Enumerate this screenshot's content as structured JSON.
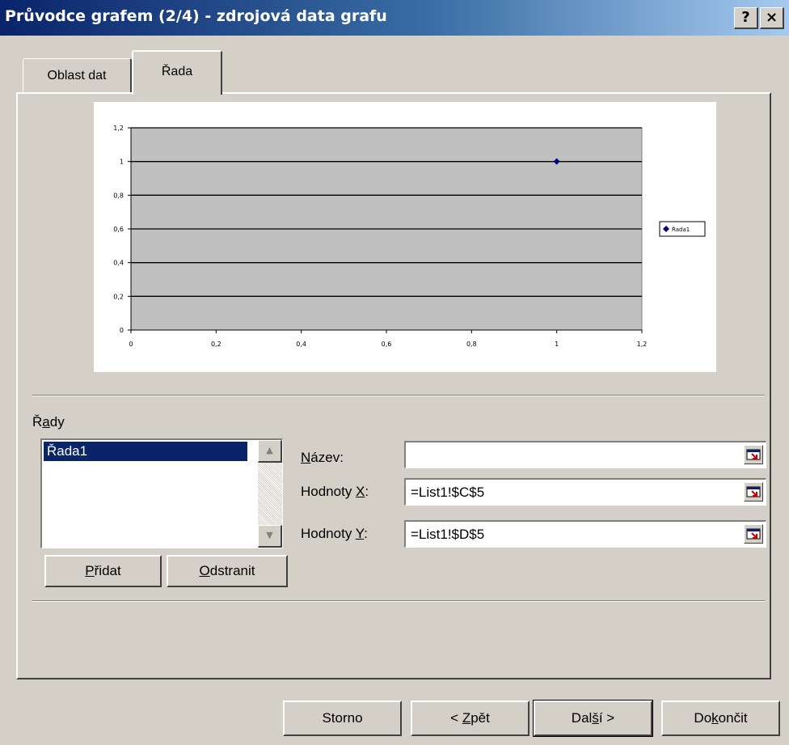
{
  "window": {
    "title": "Průvodce grafem (2/4) - zdrojová data grafu",
    "help_label": "?",
    "close_label": "×"
  },
  "tabs": [
    {
      "label": "Oblast dat",
      "active": false
    },
    {
      "label": "Řada",
      "active": true
    }
  ],
  "chart_data": {
    "type": "scatter",
    "series": [
      {
        "name": "Řada1",
        "x": [
          1
        ],
        "y": [
          1
        ],
        "color": "#000080"
      }
    ],
    "xlim": [
      0,
      1.2
    ],
    "ylim": [
      0,
      1.2
    ],
    "x_ticks": [
      "0",
      "0,2",
      "0,4",
      "0,6",
      "0,8",
      "1",
      "1,2"
    ],
    "y_ticks": [
      "0",
      "0,2",
      "0,4",
      "0,6",
      "0,8",
      "1",
      "1,2"
    ],
    "plot_bg": "#c0c0c0",
    "grid": true,
    "legend": "right"
  },
  "series_panel": {
    "label_prefix": "Ř",
    "label_underlined": "a",
    "label_suffix": "dy",
    "items": [
      "Řada1"
    ],
    "selected": "Řada1",
    "add": {
      "underlined": "P",
      "rest": "řidat"
    },
    "remove": {
      "underlined": "O",
      "rest": "dstranit"
    }
  },
  "fields": {
    "name": {
      "underlined": "N",
      "rest": "ázev:",
      "value": ""
    },
    "x_values": {
      "prefix": "Hodnoty ",
      "underlined": "X",
      "suffix": ":",
      "value": "=List1!$C$5"
    },
    "y_values": {
      "prefix": "Hodnoty ",
      "underlined": "Y",
      "suffix": ":",
      "value": "=List1!$D$5"
    }
  },
  "buttons": {
    "cancel": "Storno",
    "back": {
      "prefix": "< ",
      "underlined": "Z",
      "rest": "pět"
    },
    "next": {
      "prefix": "Dal",
      "underlined": "š",
      "rest": "í >"
    },
    "finish": {
      "prefix": "Do",
      "underlined": "k",
      "rest": "ončit"
    }
  },
  "colors": {
    "title_start": "#0a246a",
    "title_end": "#a6caf0",
    "face": "#d4d0c8",
    "selection": "#0a246a"
  }
}
